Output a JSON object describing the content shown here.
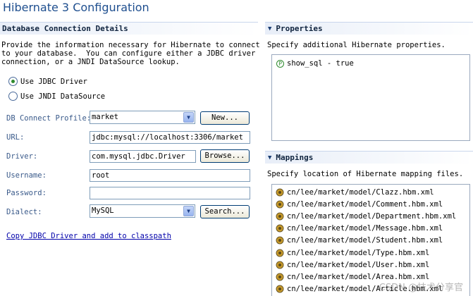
{
  "page": {
    "title": "Hibernate 3 Configuration"
  },
  "db": {
    "header": "Database Connection Details",
    "description": "Provide the information necessary for Hibernate to connect\nto your database.  You can configure either a JDBC driver\nconnection, or a JNDI DataSource lookup.",
    "radio_jdbc": "Use JDBC Driver",
    "radio_jndi": "Use JNDI DataSource",
    "selected_mode": "jdbc",
    "profile_label": "DB Connect Profile:",
    "profile_value": "market",
    "new_button": "New...",
    "url_label": "URL:",
    "url_value": "jdbc:mysql://localhost:3306/market",
    "driver_label": "Driver:",
    "driver_value": "com.mysql.jdbc.Driver",
    "browse_button": "Browse...",
    "username_label": "Username:",
    "username_value": "root",
    "password_label": "Password:",
    "password_value": "",
    "dialect_label": "Dialect:",
    "dialect_value": "MySQL",
    "search_button": "Search...",
    "copy_link": "Copy JDBC Driver and add to classpath"
  },
  "properties": {
    "header": "Properties",
    "description": "Specify additional Hibernate properties.",
    "items": [
      {
        "icon": "P",
        "text": "show_sql - true"
      }
    ]
  },
  "mappings": {
    "header": "Mappings",
    "description": "Specify location of Hibernate mapping files.",
    "items": [
      "cn/lee/market/model/Clazz.hbm.xml",
      "cn/lee/market/model/Comment.hbm.xml",
      "cn/lee/market/model/Department.hbm.xml",
      "cn/lee/market/model/Message.hbm.xml",
      "cn/lee/market/model/Student.hbm.xml",
      "cn/lee/market/model/Type.hbm.xml",
      "cn/lee/market/model/User.hbm.xml",
      "cn/lee/market/model/Area.hbm.xml",
      "cn/lee/market/model/Article.hbm.xml"
    ]
  },
  "watermark": "CSDN @技术分享官",
  "colors": {
    "title": "#1f4f8f",
    "label": "#3a5a8a",
    "link": "#0000aa",
    "selected_radio": "#2e8b2e"
  }
}
